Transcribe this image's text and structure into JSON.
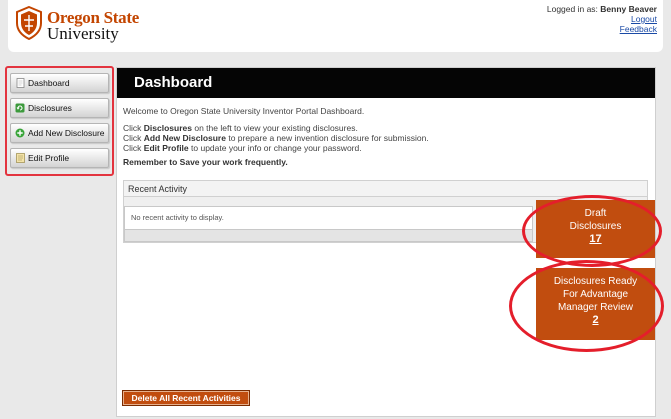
{
  "header": {
    "logo_line1": "Oregon State",
    "logo_line2": "University",
    "logged_in_prefix": "Logged in as:",
    "user_name": "Benny Beaver",
    "logout_label": "Logout",
    "feedback_label": "Feedback"
  },
  "sidebar": {
    "items": [
      {
        "label": "Dashboard",
        "icon": "page-icon"
      },
      {
        "label": "Disclosures",
        "icon": "refresh-icon"
      },
      {
        "label": "Add New Disclosure",
        "icon": "plus-icon"
      },
      {
        "label": "Edit Profile",
        "icon": "note-icon"
      }
    ]
  },
  "main": {
    "title": "Dashboard",
    "welcome": "Welcome to Oregon State University Inventor Portal Dashboard.",
    "lines": [
      {
        "pre": "Click ",
        "bold": "Disclosures",
        "post": " on the left to view your existing disclosures."
      },
      {
        "pre": "Click ",
        "bold": "Add New Disclosure",
        "post": " to prepare a new invention disclosure for submission."
      },
      {
        "pre": "Click ",
        "bold": "Edit Profile",
        "post": " to update your info or change your password."
      }
    ],
    "remember": "Remember to Save your work frequently.",
    "recent_activity": {
      "header": "Recent Activity",
      "empty_text": "No recent activity to display."
    },
    "cards": {
      "draft": {
        "line1": "Draft",
        "line2": "Disclosures",
        "count": "17"
      },
      "ready": {
        "line1": "Disclosures Ready",
        "line2": "For Advantage",
        "line3": "Manager Review",
        "count": "2"
      }
    },
    "delete_button": "Delete All Recent Activities"
  },
  "colors": {
    "brand_orange": "#c34500",
    "card_orange": "#c14d0f",
    "highlight_red": "#e41e2b",
    "title_bar": "#050505"
  }
}
